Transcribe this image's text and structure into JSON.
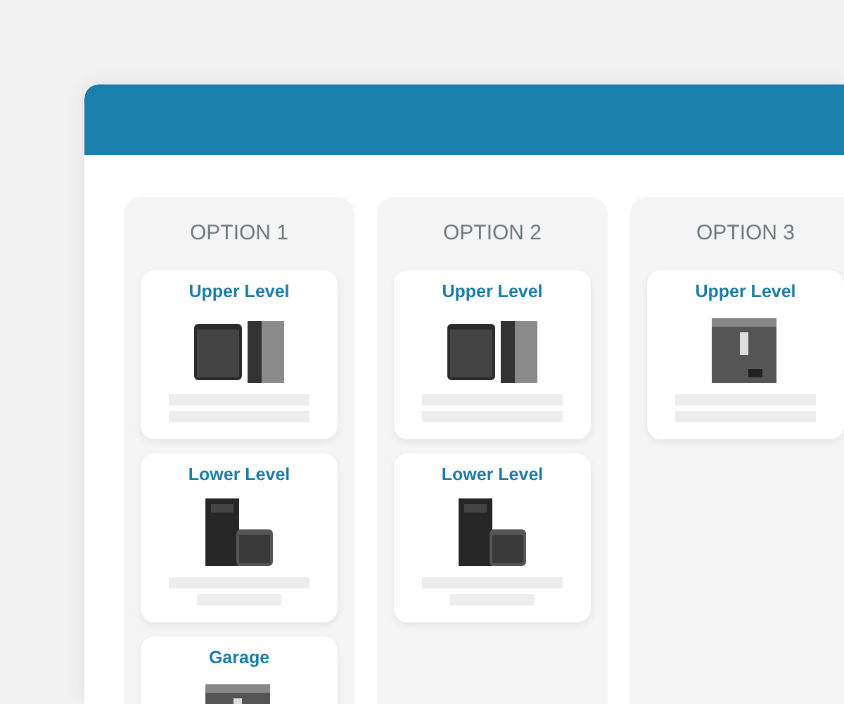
{
  "options": [
    {
      "title": "OPTION 1",
      "cards": [
        {
          "title": "Upper Level",
          "image": {
            "kind": "picture"
          },
          "lines": [
            {
              "kind": "long"
            },
            {
              "kind": "long"
            }
          ]
        },
        {
          "title": "Lower Level",
          "image": {
            "kind": "picture"
          },
          "lines": [
            {
              "kind": "long"
            },
            {
              "kind": "short"
            }
          ]
        },
        {
          "title": "Garage",
          "image": {
            "kind": "picture"
          }
        }
      ]
    },
    {
      "title": "OPTION 2",
      "cards": [
        {
          "title": "Upper Level",
          "image": {
            "kind": "picture"
          },
          "lines": [
            {
              "kind": "long"
            },
            {
              "kind": "long"
            }
          ]
        },
        {
          "title": "Lower Level",
          "image": {
            "kind": "picture"
          },
          "lines": [
            {
              "kind": "long"
            },
            {
              "kind": "short"
            }
          ]
        }
      ]
    },
    {
      "title": "OPTION 3",
      "cards": [
        {
          "title": "Upper Level",
          "image": {
            "kind": "picture"
          },
          "lines": [
            {
              "kind": "long"
            },
            {
              "kind": "long"
            }
          ]
        }
      ]
    }
  ]
}
